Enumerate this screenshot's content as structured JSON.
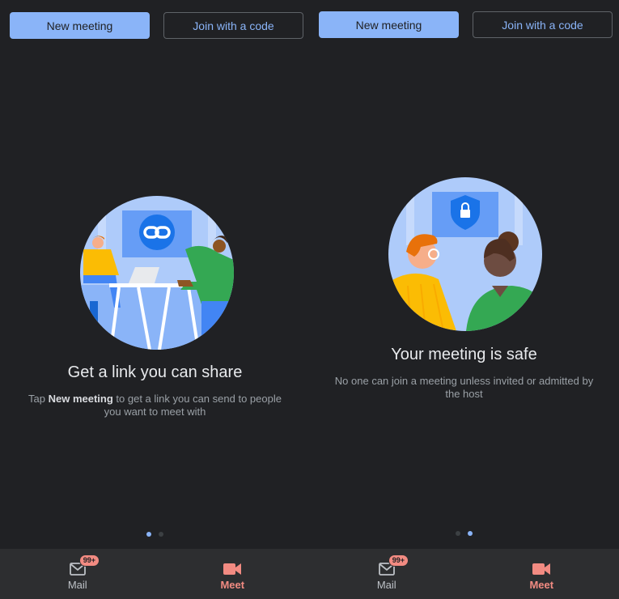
{
  "screens": [
    {
      "top_buttons": {
        "new_meeting": "New meeting",
        "join_code": "Join with a code"
      },
      "title": "Get a link you can share",
      "desc_prefix": "Tap ",
      "desc_bold": "New meeting",
      "desc_suffix": " to get a link you can send to people you want to meet with",
      "illustration_icon": "link-icon",
      "active_page": 1,
      "nav": {
        "mail_label": "Mail",
        "mail_badge": "99+",
        "meet_label": "Meet"
      }
    },
    {
      "top_buttons": {
        "new_meeting": "New meeting",
        "join_code": "Join with a code"
      },
      "title": "Your meeting is safe",
      "desc": "No one can join a meeting unless invited or admitted by the host",
      "illustration_icon": "shield-lock-icon",
      "active_page": 2,
      "nav": {
        "mail_label": "Mail",
        "mail_badge": "99+",
        "meet_label": "Meet"
      }
    }
  ],
  "colors": {
    "background": "#202124",
    "accent": "#8ab4f8",
    "meet_red": "#f28b82",
    "nav_bg": "#2d2e30"
  }
}
